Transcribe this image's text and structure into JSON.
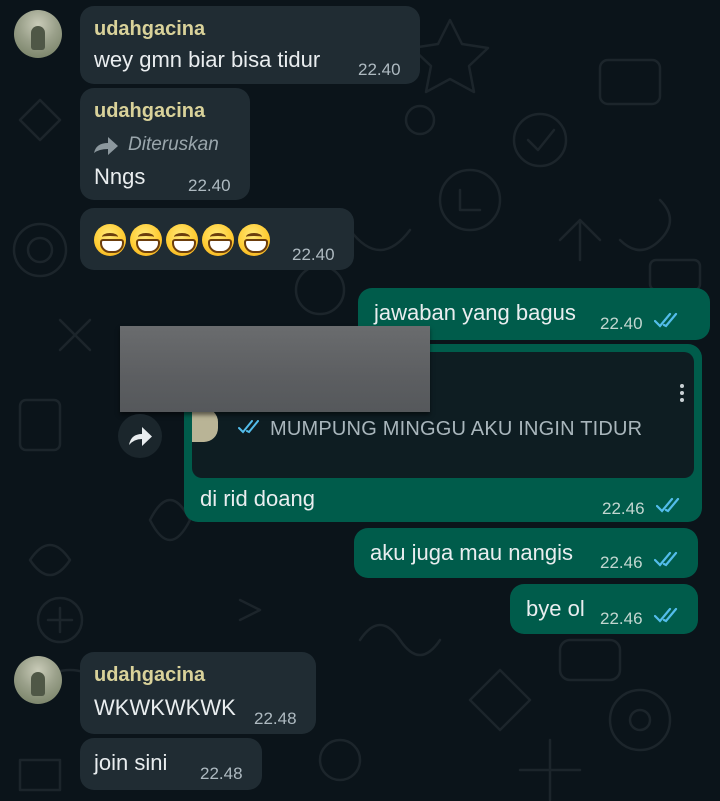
{
  "chat": {
    "contact_name": "udahgacina",
    "forwarded_label": "Diteruskan",
    "messages": [
      {
        "text": "wey gmn biar bisa tidur",
        "time": "22.40"
      },
      {
        "text": "Nngs",
        "time": "22.40"
      },
      {
        "emoji": "😁😁😁😁😁",
        "time": "22.40"
      },
      {
        "text": "jawaban yang bagus",
        "time": "22.40",
        "status": "read"
      },
      {
        "quoted": "MUMPUNG MINGGU AKU INGIN TIDUR",
        "text": "di rid doang",
        "time": "22.46",
        "status": "read"
      },
      {
        "text": "aku juga mau nangis",
        "time": "22.46",
        "status": "read"
      },
      {
        "text": "bye ol",
        "time": "22.46",
        "status": "read"
      },
      {
        "text": "WKWKWKWK",
        "time": "22.48"
      },
      {
        "text": "join sini",
        "time": "22.48"
      }
    ]
  },
  "colors": {
    "background": "#0b141a",
    "incoming_bubble": "#202c33",
    "outgoing_bubble": "#005c4b",
    "sender_name": "#d9d29a",
    "read_ticks": "#53bdeb"
  },
  "icons": {
    "forward": "forward-arrow-icon",
    "share": "share-arrow-icon",
    "read": "double-check-icon",
    "more": "more-vertical-icon"
  }
}
